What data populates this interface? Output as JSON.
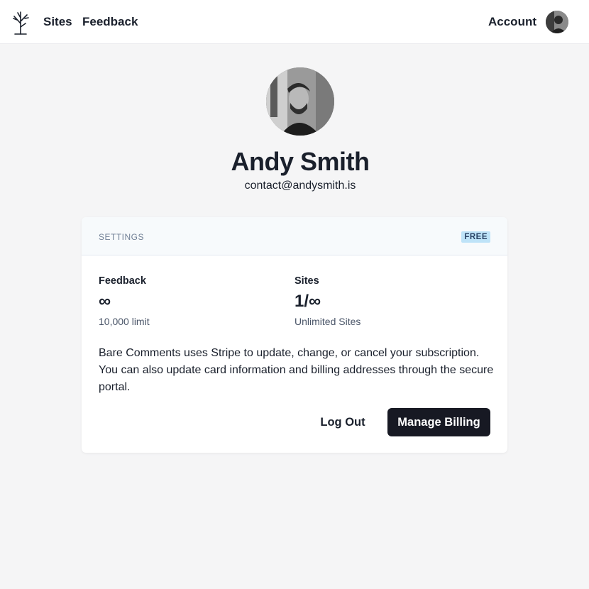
{
  "navbar": {
    "logo_icon": "tree-icon",
    "sites_label": "Sites",
    "feedback_label": "Feedback",
    "account_label": "Account"
  },
  "profile": {
    "name": "Andy Smith",
    "email": "contact@andysmith.is"
  },
  "settings": {
    "title": "SETTINGS",
    "plan_badge": "FREE",
    "stats": {
      "feedback": {
        "label": "Feedback",
        "value": "∞",
        "help": "10,000 limit"
      },
      "sites": {
        "label": "Sites",
        "value": "1/∞",
        "help": "Unlimited Sites"
      }
    },
    "description": "Bare Comments uses Stripe to update, change, or cancel your subscription. You can also update card information and billing addresses through the secure portal.",
    "logout_label": "Log Out",
    "billing_label": "Manage Billing"
  },
  "colors": {
    "page_background": "#f5f5f6",
    "primary_button": "#171923",
    "badge_background": "#bee3f8",
    "badge_text": "#2a4365"
  }
}
